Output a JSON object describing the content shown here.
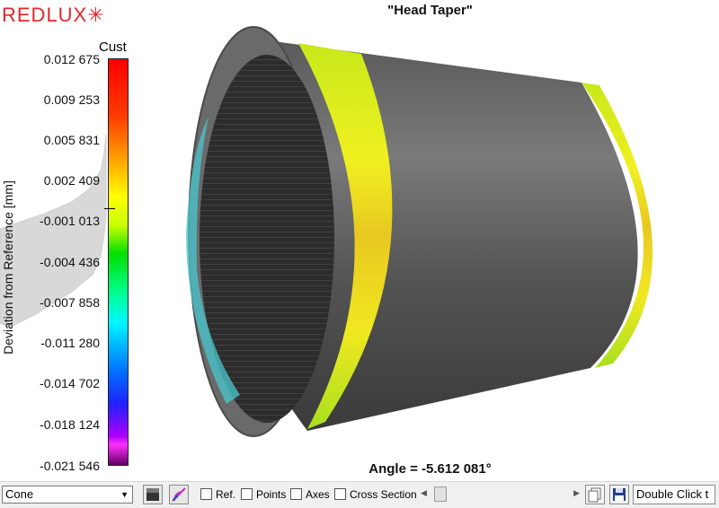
{
  "app": {
    "logo": "REDLUX",
    "logo_x": "✳"
  },
  "colorbar": {
    "header": "Cust",
    "axis_label": "Deviation from Reference [mm]",
    "ticks": [
      "0.012 675",
      "0.009 253",
      "0.005 831",
      "0.002 409",
      "-0.001 013",
      "-0.004 436",
      "-0.007 858",
      "-0.011 280",
      "-0.014 702",
      "-0.018 124",
      "-0.021 546"
    ]
  },
  "viewport": {
    "title": "\"Head Taper\"",
    "angle": "Angle = -5.612 081°"
  },
  "toolbar": {
    "mode_select": "Cone",
    "ref_label": "Ref.",
    "points_label": "Points",
    "axes_label": "Axes",
    "cross_section_label": "Cross Section",
    "double_click_text": "Double Click t"
  }
}
